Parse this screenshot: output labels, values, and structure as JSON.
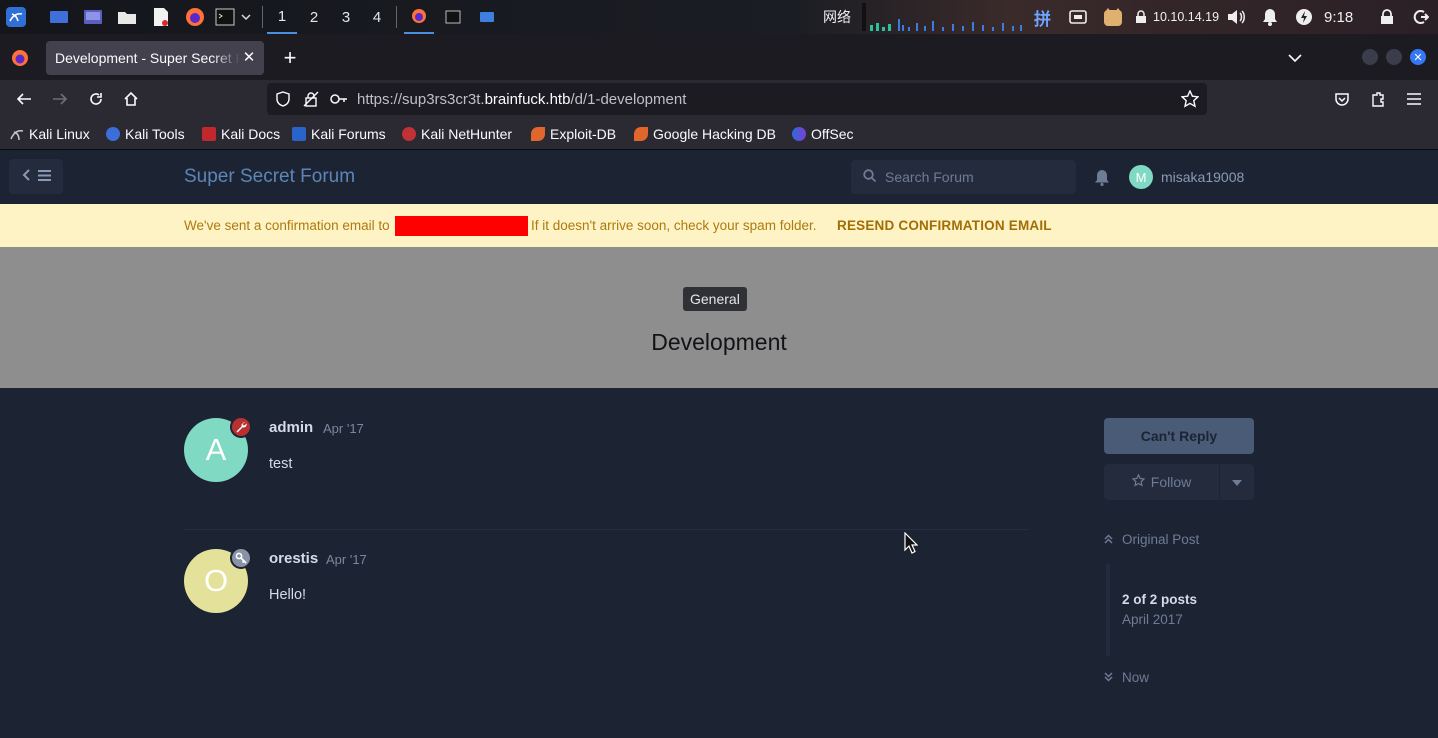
{
  "os_panel": {
    "workspaces": [
      "1",
      "2",
      "3",
      "4"
    ],
    "active_workspace": "1",
    "network_label": "网络",
    "ime_label": "拼",
    "ip_address": "10.10.14.19",
    "clock": "9:18"
  },
  "browser": {
    "tab_title": "Development - Super Secret Forum",
    "url_prefix": "https://sup3rs3cr3t.",
    "url_host": "brainfuck.htb",
    "url_path": "/d/1-development",
    "bookmarks": [
      "Kali Linux",
      "Kali Tools",
      "Kali Docs",
      "Kali Forums",
      "Kali NetHunter",
      "Exploit-DB",
      "Google Hacking DB",
      "OffSec"
    ]
  },
  "forum": {
    "title": "Super Secret Forum",
    "search_placeholder": "Search Forum",
    "user_initial": "M",
    "username": "misaka19008"
  },
  "alert": {
    "message_part1": "We've sent a confirmation email to",
    "message_part2": "If it doesn't arrive soon, check your spam folder.",
    "resend_label": "RESEND CONFIRMATION EMAIL"
  },
  "discussion": {
    "tag": "General",
    "title": "Development"
  },
  "posts": [
    {
      "initial": "A",
      "author": "admin",
      "time": "Apr '17",
      "body": "test",
      "avatar_color": "#7fd9c3",
      "badge_color": "#b8312f"
    },
    {
      "initial": "O",
      "author": "orestis",
      "time": "Apr '17",
      "body": "Hello!",
      "avatar_color": "#e3e19a",
      "badge_color": "#8a93a6"
    }
  ],
  "sidebar": {
    "reply_label": "Can't Reply",
    "follow_label": "Follow",
    "original_post_label": "Original Post",
    "post_count": "2 of 2 posts",
    "post_date": "April 2017",
    "now_label": "Now"
  },
  "colors": {
    "accent": "#5d86b8",
    "alert_bg": "#fdf3c5",
    "page_bg": "#1c2333",
    "hero_bg": "#8e8e8e"
  }
}
